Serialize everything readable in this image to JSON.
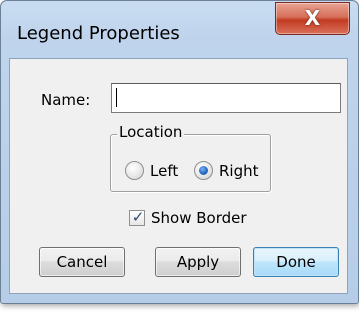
{
  "window": {
    "title": "Legend Properties",
    "close_glyph": "X"
  },
  "form": {
    "name_label": "Name:",
    "name_value": "",
    "location": {
      "legend": "Location",
      "options": [
        {
          "label": "Left",
          "selected": false
        },
        {
          "label": "Right",
          "selected": true
        }
      ]
    },
    "show_border": {
      "label": "Show Border",
      "checked": true,
      "check_glyph": "✓"
    }
  },
  "buttons": {
    "cancel": "Cancel",
    "apply": "Apply",
    "done": "Done"
  },
  "colors": {
    "title_bar": "#bfd4ec",
    "close_button": "#c23b22",
    "default_button_border": "#3c7fb1",
    "radio_selected": "#2a6fc9"
  },
  "icons": {
    "close": "close-icon",
    "radio": "radio-button",
    "check": "checkmark-icon"
  }
}
